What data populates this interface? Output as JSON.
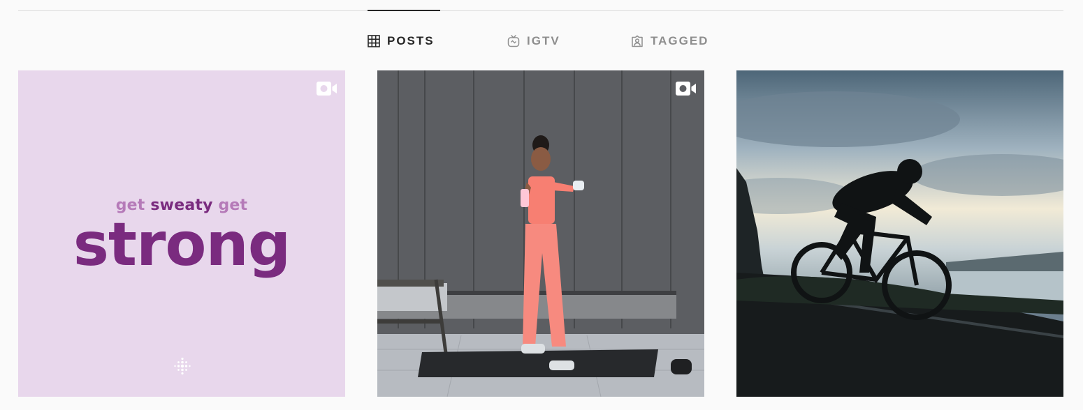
{
  "tabs": [
    {
      "label": "POSTS",
      "icon": "grid-icon",
      "active": true
    },
    {
      "label": "IGTV",
      "icon": "igtv-icon",
      "active": false
    },
    {
      "label": "TAGGED",
      "icon": "tagged-icon",
      "active": false
    }
  ],
  "posts": [
    {
      "type": "video",
      "icon": "video-icon",
      "background": "#e8d7ec",
      "text": {
        "line1_a": "get",
        "line1_b": "sweaty",
        "line1_c": "get",
        "line2": "strong"
      },
      "logo": "fitbit-logo"
    },
    {
      "type": "video",
      "icon": "video-icon",
      "content": "workout-photo"
    },
    {
      "type": "image",
      "content": "cyclist-photo"
    }
  ],
  "colors": {
    "active_tab": "#262626",
    "inactive_tab": "#8e8e8e",
    "promo_dark": "#7a2b7f",
    "promo_light": "#b57ab8"
  }
}
